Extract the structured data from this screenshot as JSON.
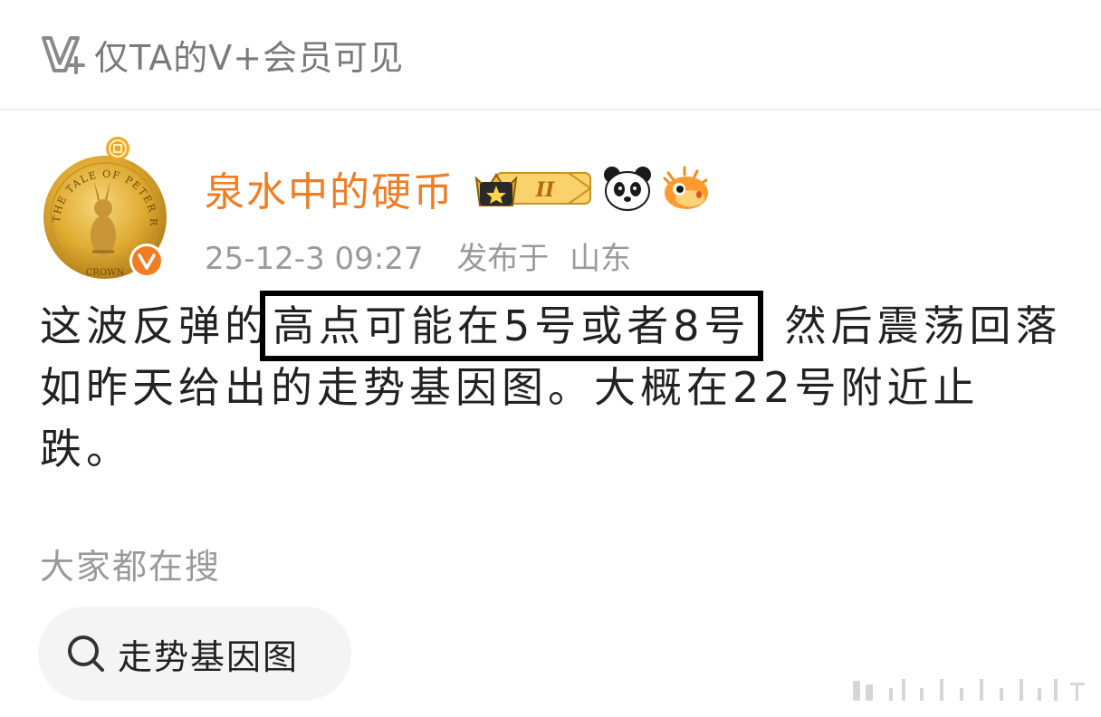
{
  "header": {
    "visibility_text": "仅TA的V+会员可见",
    "icon": "v-plus-logo-icon"
  },
  "post": {
    "author": {
      "name": "泉水中的硬币",
      "name_color": "#f07d23",
      "avatar": "peter-rabbit-coin-avatar",
      "avatar_coin_text": "THE TALE OF PETER RABBIT",
      "avatar_coin_bottom": "CROWN",
      "verified_icon": "verified-v-icon",
      "badges": [
        "vip-crown-badge",
        "panda-emoji-icon",
        "pufferfish-emoji-icon"
      ],
      "vip_level_text": "II"
    },
    "timestamp": "25-12-3 09:27",
    "location_label": "发布于",
    "location": "山东",
    "text": {
      "part1": "这波反弹的",
      "highlight": "高点可能在5号或者8号",
      "part2": "然后震荡回落如昨天给出的走势基因图。大概在22号附近止跌。"
    }
  },
  "search": {
    "label": "大家都在搜",
    "chip": "走势基因图",
    "icon": "search-icon"
  },
  "colors": {
    "accent": "#f07d23",
    "gray_text": "#9a9a9a",
    "chip_bg": "#f4f4f4",
    "verified": "#f27c22",
    "gold": "#d9a52c"
  }
}
